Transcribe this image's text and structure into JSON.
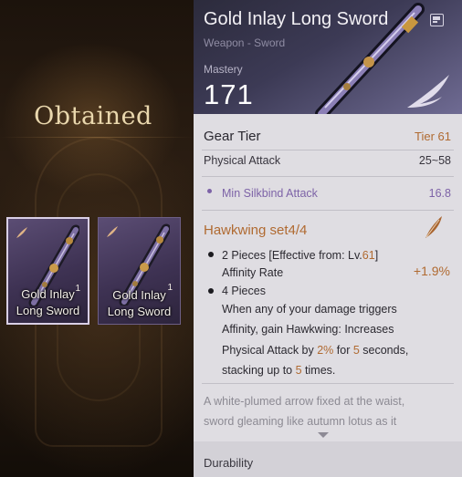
{
  "left": {
    "heading": "Obtained",
    "items": [
      {
        "name_line1": "Gold Inlay",
        "name_line2": "Long Sword",
        "qty": "1",
        "selected": true
      },
      {
        "name_line1": "Gold Inlay",
        "name_line2": "Long Sword",
        "qty": "1",
        "selected": false
      }
    ]
  },
  "tooltip": {
    "title": "Gold Inlay Long Sword",
    "subtitle": "Weapon - Sword",
    "mastery_label": "Mastery",
    "mastery_value": "171",
    "compare_icon": "compare-icon",
    "gear_tier_label": "Gear Tier",
    "gear_tier_value": "Tier 61",
    "physical_attack_label": "Physical Attack",
    "physical_attack_value": "25~58",
    "min_silkbind_label": "Min Silkbind Attack",
    "min_silkbind_value": "16.8",
    "set": {
      "title": "Hawkwing set4/4",
      "icon": "feather-icon",
      "piece2_prefix": "2 Pieces [Effective from: Lv.",
      "piece2_level": "61",
      "piece2_suffix": "]",
      "piece2_stat": "Affinity Rate",
      "piece2_value": "+1.9%",
      "piece4_title": "4 Pieces",
      "piece4_line1": "When any of your damage triggers",
      "piece4_line2": "Affinity, gain Hawkwing: Increases",
      "piece4_line3_a": "Physical Attack by ",
      "piece4_line3_pct": "2%",
      "piece4_line3_b": " for ",
      "piece4_line3_sec": "5",
      "piece4_line3_c": " seconds,",
      "piece4_line4_a": "stacking up to ",
      "piece4_line4_n": "5",
      "piece4_line4_b": " times."
    },
    "flavor_line1": "A white-plumed arrow fixed at the waist,",
    "flavor_line2": "sword gleaming like autumn lotus as it",
    "durability_label": "Durability"
  },
  "colors": {
    "accent_orange": "#b06a31",
    "silkbind_purple": "#7d63a7",
    "panel_bg": "#dfdde2",
    "item_card": "#4b3f62"
  }
}
